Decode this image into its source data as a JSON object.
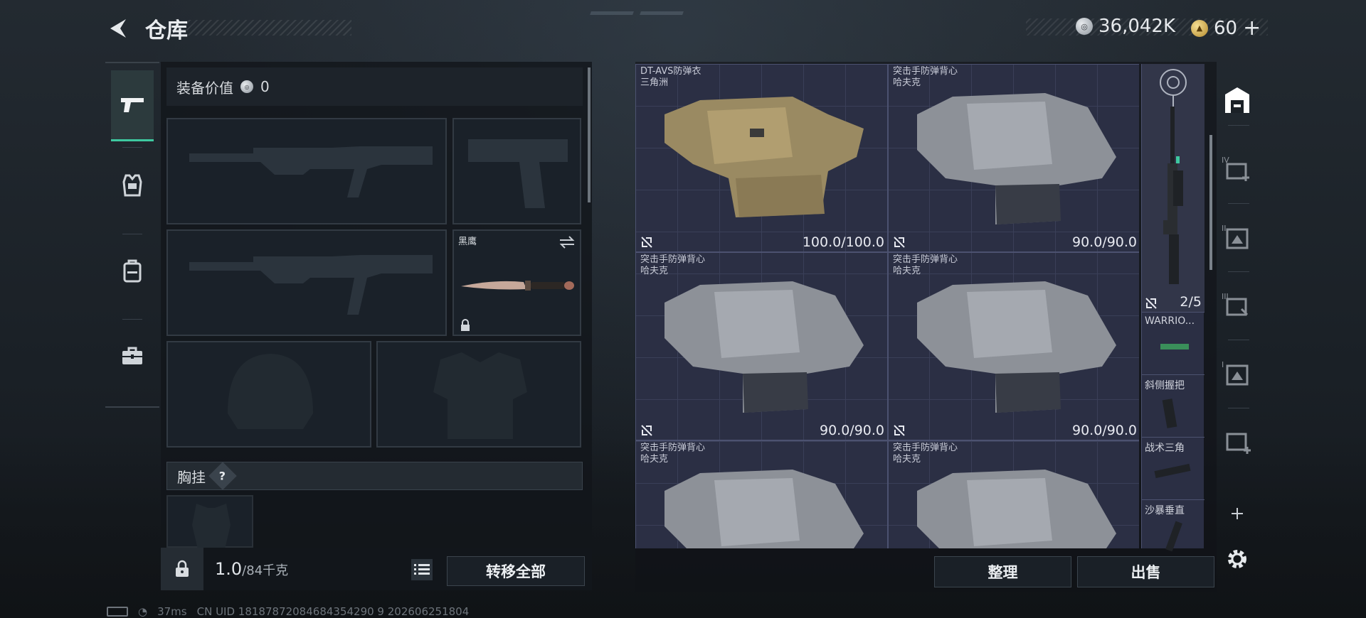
{
  "header": {
    "title": "仓库",
    "silver_amount": "36,042K",
    "gold_amount": "60",
    "gold_add": "+"
  },
  "left_tabs": [
    {
      "name": "weapons-tab",
      "icon": "pistol-icon",
      "active": true
    },
    {
      "name": "armor-tab",
      "icon": "vest-icon",
      "active": false
    },
    {
      "name": "backpack-tab",
      "icon": "backpack-icon",
      "active": false
    },
    {
      "name": "case-tab",
      "icon": "briefcase-icon",
      "active": false
    }
  ],
  "loadout": {
    "value_label": "装备价值",
    "value_amount": "0",
    "melee_name": "黑鹰",
    "chest_rig_label": "胸挂",
    "help_glyph": "?",
    "weight_current": "1.0",
    "weight_max": "/84千克",
    "transfer_all_label": "转移全部"
  },
  "storage": {
    "items": [
      {
        "name": "DT-AVS防弹衣",
        "sub": "三角洲",
        "durability": "100.0/100.0",
        "variant": "tan"
      },
      {
        "name": "突击手防弹背心",
        "sub": "哈夫克",
        "durability": "90.0/90.0",
        "variant": "grey"
      },
      {
        "name": "突击手防弹背心",
        "sub": "哈夫克",
        "durability": "90.0/90.0",
        "variant": "grey"
      },
      {
        "name": "突击手防弹背心",
        "sub": "哈夫克",
        "durability": "90.0/90.0",
        "variant": "grey"
      },
      {
        "name": "突击手防弹背心",
        "sub": "哈夫克",
        "durability": "",
        "variant": "grey"
      },
      {
        "name": "突击手防弹背心",
        "sub": "哈夫克",
        "durability": "",
        "variant": "grey"
      }
    ],
    "side_items": {
      "rifle_count": "2/5",
      "item_1": "WARRIO...",
      "item_2": "斜侧握把",
      "item_3": "战术三角",
      "item_4": "沙暴垂直"
    },
    "sort_label": "整理",
    "sell_label": "出售"
  },
  "right_sidebar": [
    {
      "name": "storage-main-icon"
    },
    {
      "name": "storage-expand-4-icon",
      "roman": "IV"
    },
    {
      "name": "storage-slot-2-icon",
      "roman": "II"
    },
    {
      "name": "storage-slot-3-icon",
      "roman": "III"
    },
    {
      "name": "storage-slot-1-icon",
      "roman": "I"
    },
    {
      "name": "storage-add-icon"
    }
  ],
  "status_bar": {
    "ping": "37ms",
    "uid": "CN UID 18187872084684354290 9 202606251804"
  },
  "colors": {
    "accent_green": "#3ec9a0",
    "grid_bg": "#2b2f44",
    "panel_bg": "#12161b"
  }
}
